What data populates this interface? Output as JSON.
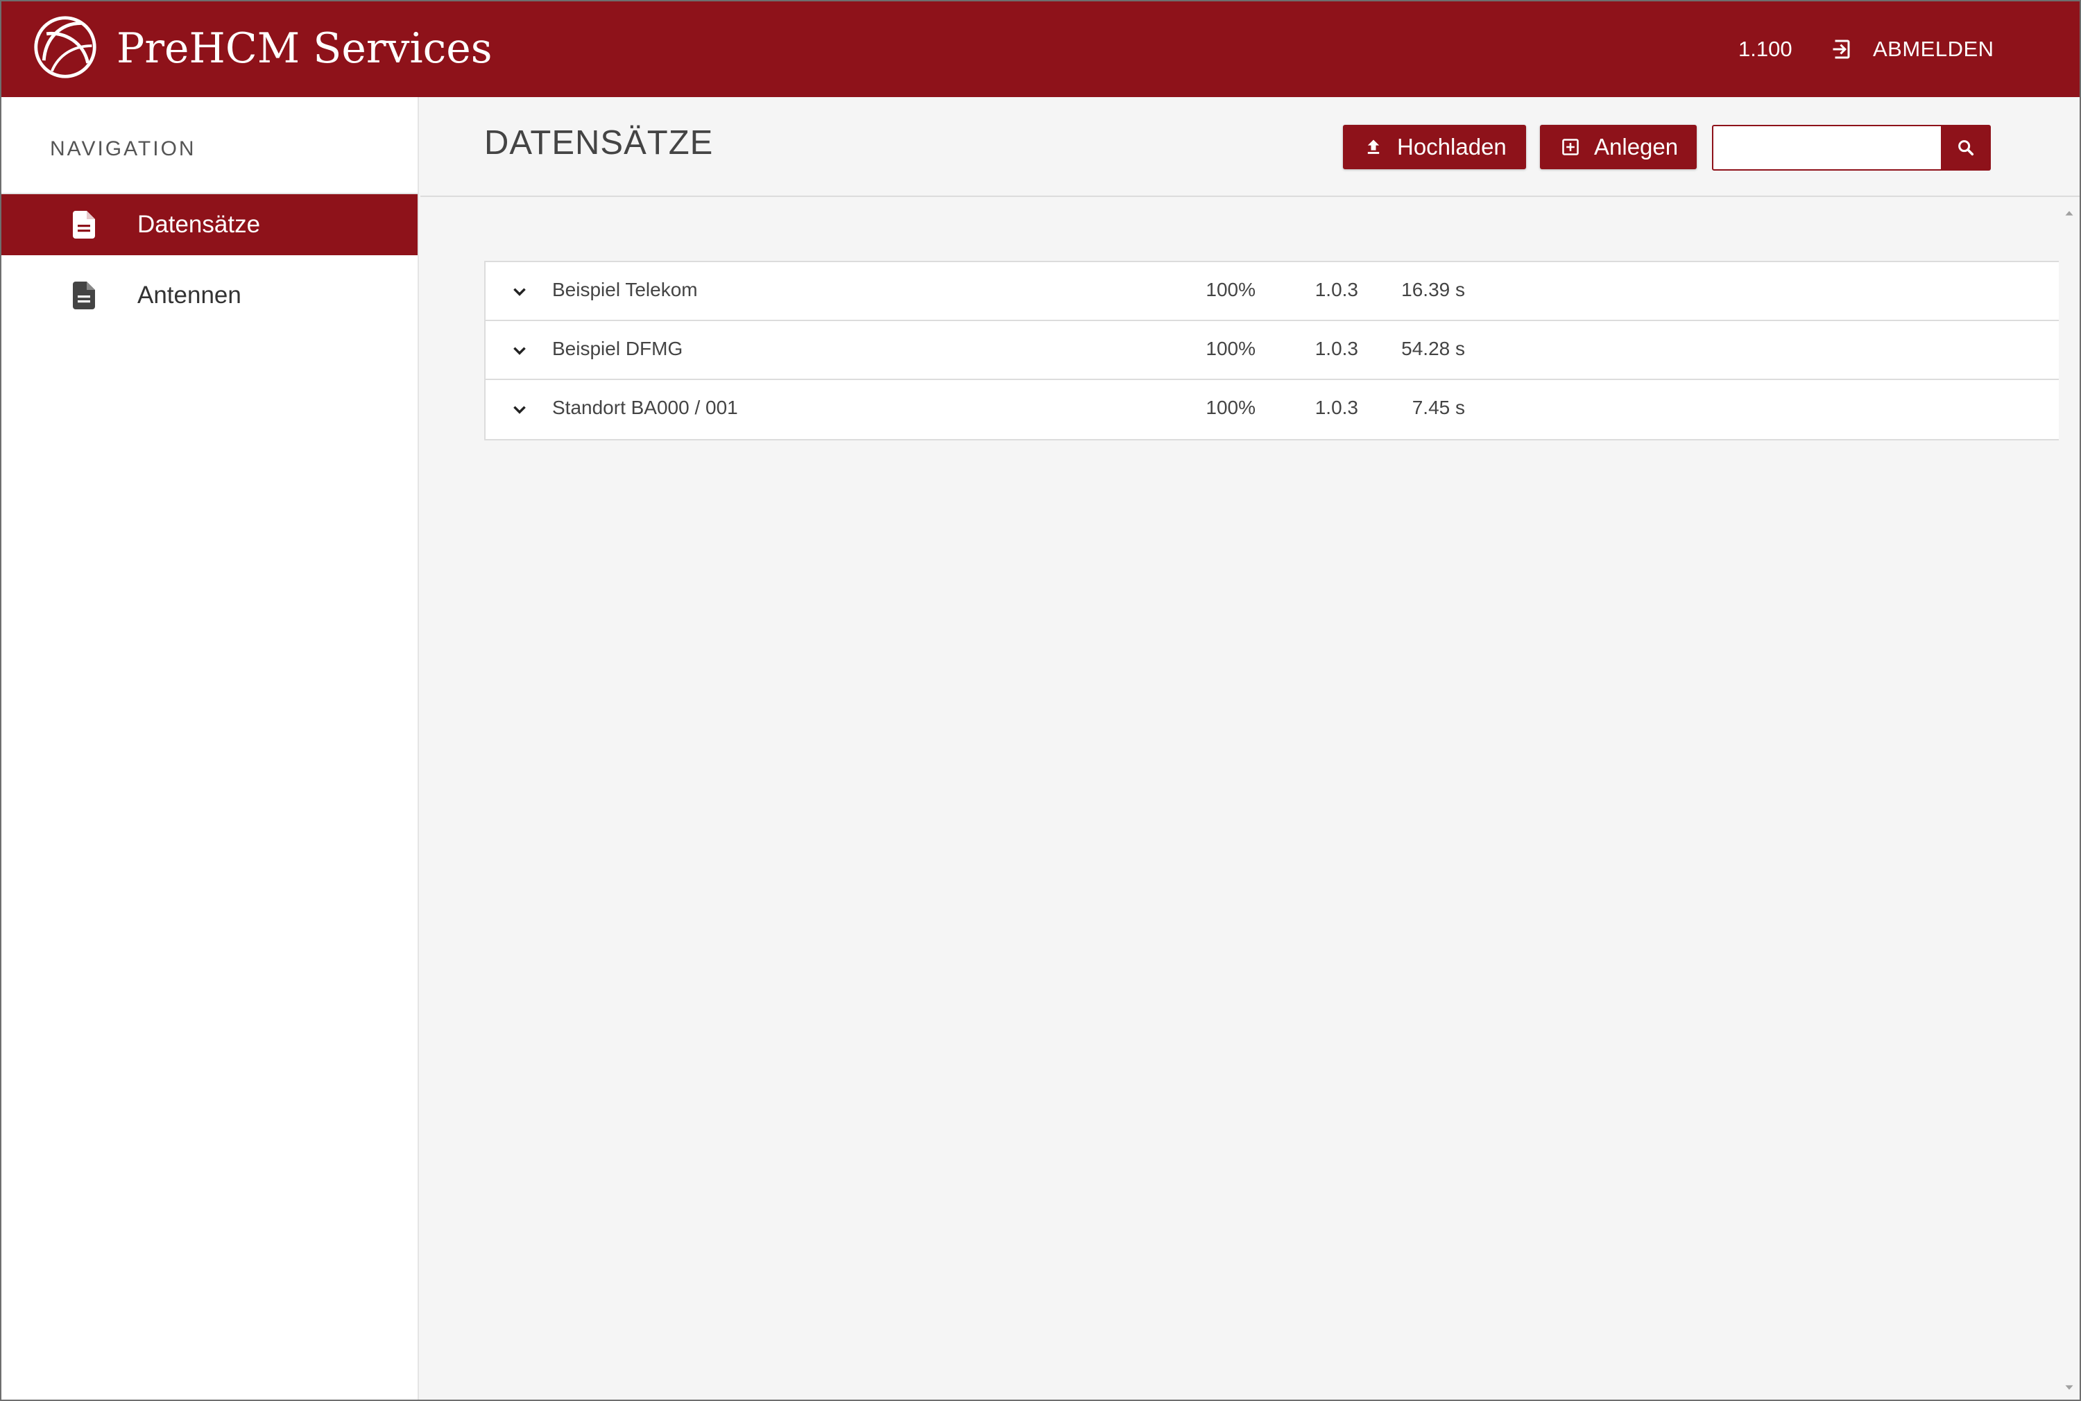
{
  "header": {
    "app_title": "PreHCM Services",
    "version": "1.100",
    "logout_label": "ABMELDEN",
    "background_color": "#8e121a"
  },
  "sidebar": {
    "heading": "NAVIGATION",
    "items": [
      {
        "label": "Datensätze",
        "icon": "document-icon",
        "active": true
      },
      {
        "label": "Antennen",
        "icon": "document-icon",
        "active": false
      }
    ]
  },
  "main": {
    "title": "DATENSÄTZE",
    "upload_label": "Hochladen",
    "create_label": "Anlegen",
    "search": {
      "value": "",
      "placeholder": ""
    }
  },
  "datasets": [
    {
      "name": "Beispiel Telekom",
      "progress": "100%",
      "version": "1.0.3",
      "duration": "16.39 s"
    },
    {
      "name": "Beispiel DFMG",
      "progress": "100%",
      "version": "1.0.3",
      "duration": "54.28 s"
    },
    {
      "name": "Standort BA000 / 001",
      "progress": "100%",
      "version": "1.0.3",
      "duration": "7.45 s"
    }
  ]
}
